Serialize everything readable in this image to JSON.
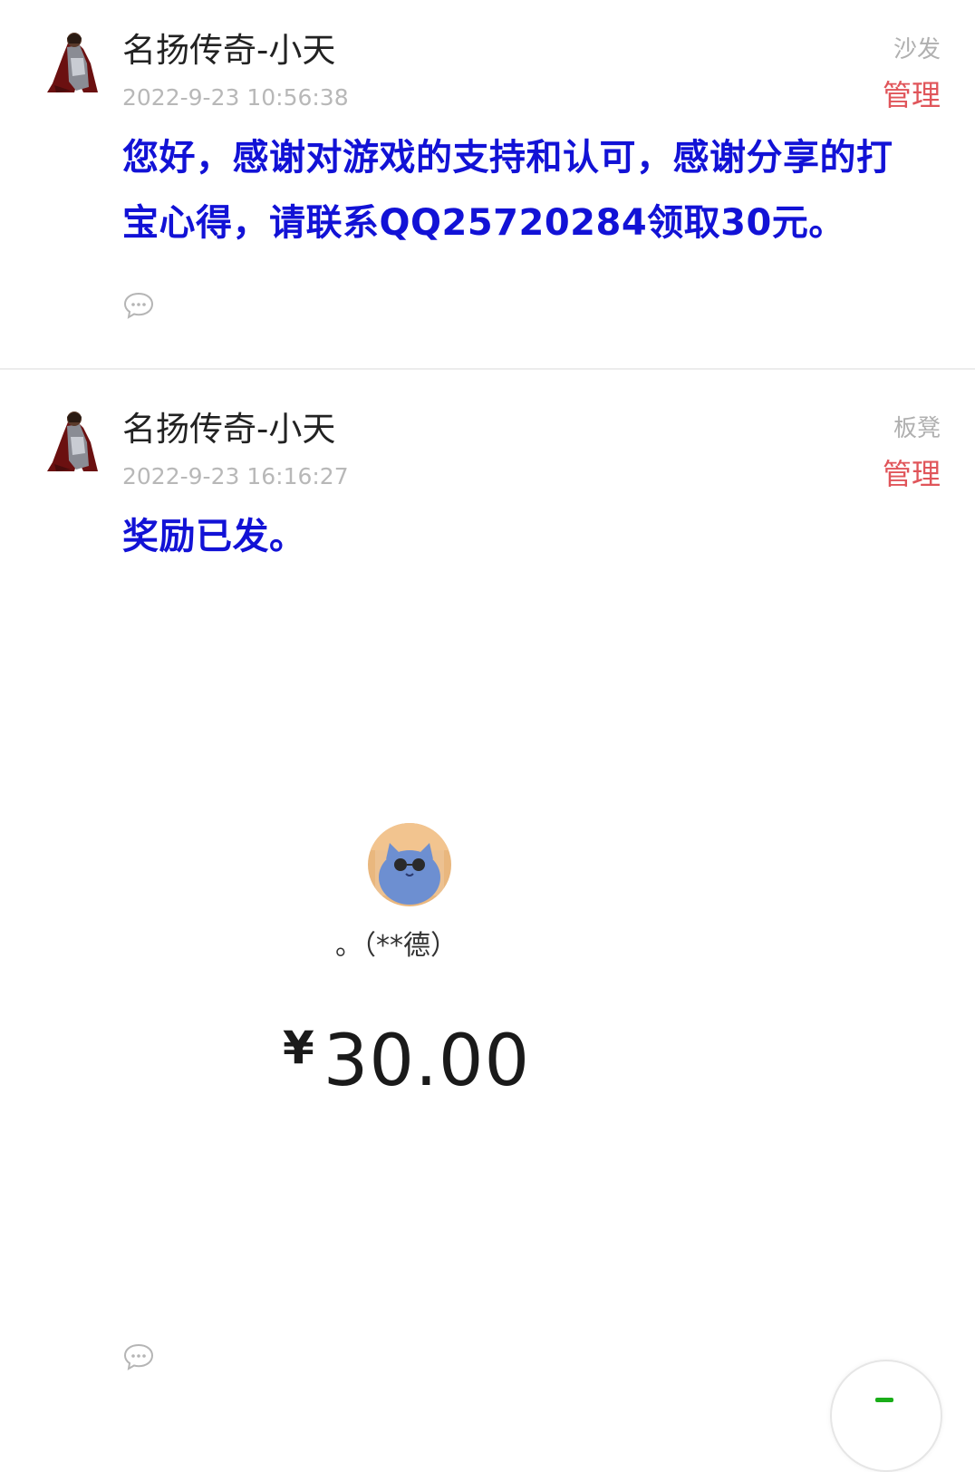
{
  "posts": [
    {
      "author": "名扬传奇-小天",
      "timestamp": "2022-9-23 10:56:38",
      "floor": "沙发",
      "manage_label": "管理",
      "content": "您好，感谢对游戏的支持和认可，感谢分享的打宝心得，请联系QQ25720284领取30元。"
    },
    {
      "author": "名扬传奇-小天",
      "timestamp": "2022-9-23 16:16:27",
      "floor": "板凳",
      "manage_label": "管理",
      "content": "奖励已发。",
      "payment": {
        "payer": "。（**德）",
        "currency": "¥",
        "amount": "30.00"
      }
    }
  ],
  "colors": {
    "content_text": "#1212d6",
    "manage_text": "#e0555a",
    "timestamp_text": "#b8b8b8",
    "fab_accent": "#1aad19"
  },
  "icons": {
    "comment": "comment-bubble-icon",
    "author_avatar": "warrior-avatar",
    "payer_avatar": "blue-cat-avatar"
  }
}
